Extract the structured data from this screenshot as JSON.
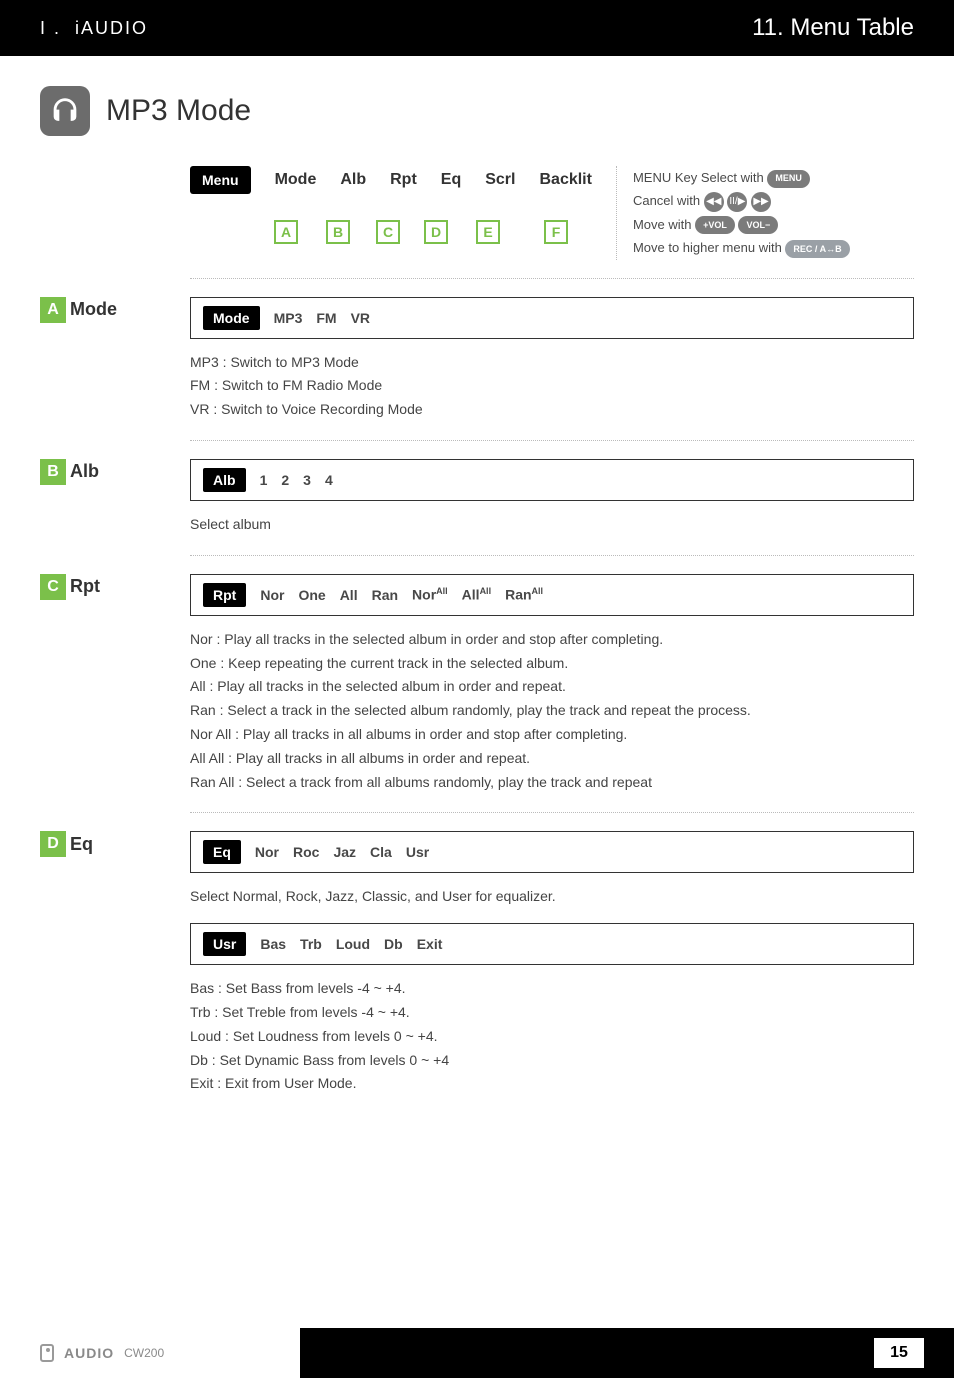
{
  "topbar": {
    "left_prefix": "I .",
    "left_brand": "iAUDIO",
    "right": "11. Menu Table"
  },
  "heading": "MP3 Mode",
  "menu_row": {
    "first": "Menu",
    "items": [
      "Mode",
      "Alb",
      "Rpt",
      "Eq",
      "Scrl",
      "Backlit"
    ],
    "letters": [
      "A",
      "B",
      "C",
      "D",
      "E",
      "F"
    ]
  },
  "help": {
    "l1a": "MENU Key Select with ",
    "l1b": "MENU",
    "l2a": "Cancel with ",
    "l3a": "Move with ",
    "l3b": "+VOL",
    "l3c": "VOL−",
    "l4a": "Move to higher menu with ",
    "l4b": "REC / A↔B"
  },
  "sections": {
    "A": {
      "letter": "A",
      "title": "Mode",
      "bar": {
        "active": "Mode",
        "opts": [
          "MP3",
          "FM",
          "VR"
        ]
      },
      "desc": [
        "MP3 : Switch to MP3 Mode",
        "FM : Switch to FM Radio Mode",
        "VR : Switch to Voice Recording Mode"
      ]
    },
    "B": {
      "letter": "B",
      "title": "Alb",
      "bar": {
        "active": "Alb",
        "opts": [
          "1",
          "2",
          "3",
          "4"
        ]
      },
      "desc": [
        "Select album"
      ]
    },
    "C": {
      "letter": "C",
      "title": "Rpt",
      "bar": {
        "active": "Rpt",
        "opts": [
          "Nor",
          "One",
          "All",
          "Ran"
        ],
        "sup": [
          "Nor",
          "All",
          "Ran"
        ],
        "supTag": "All"
      },
      "desc": [
        "Nor : Play all tracks in the selected album in order and stop after completing.",
        "One : Keep repeating the current track in the selected album.",
        "All : Play all tracks in the selected album in order and repeat.",
        "Ran : Select a track in the selected album randomly, play the track and repeat the process.",
        "Nor All : Play all tracks in all albums in order and stop after completing.",
        "All All : Play all tracks in all albums in order and repeat.",
        "Ran All : Select a track from all albums randomly, play the track and repeat"
      ]
    },
    "D": {
      "letter": "D",
      "title": "Eq",
      "bar1": {
        "active": "Eq",
        "opts": [
          "Nor",
          "Roc",
          "Jaz",
          "Cla",
          "Usr"
        ]
      },
      "mid": "Select Normal, Rock, Jazz, Classic, and User for equalizer.",
      "bar2": {
        "active": "Usr",
        "opts": [
          "Bas",
          "Trb",
          "Loud",
          "Db",
          "Exit"
        ]
      },
      "desc": [
        "Bas : Set Bass from levels -4 ~ +4.",
        "Trb : Set Treble from levels -4 ~ +4.",
        "Loud : Set Loudness from levels 0 ~ +4.",
        "Db : Set Dynamic Bass from levels 0 ~ +4",
        "Exit : Exit from User Mode."
      ]
    }
  },
  "footer": {
    "brand_prefix": "i",
    "brand": "AUDIO",
    "model": "CW200",
    "page": "15"
  }
}
